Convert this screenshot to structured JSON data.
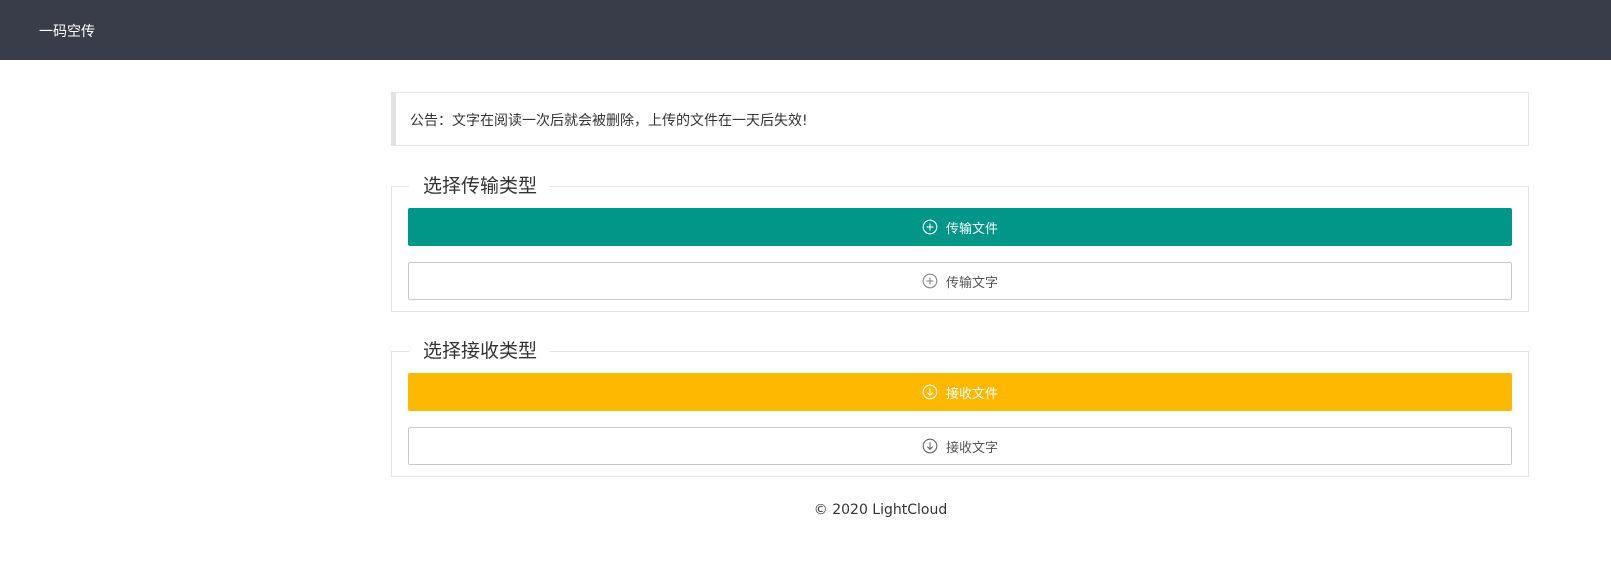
{
  "header": {
    "logo_text": "一码空传"
  },
  "notice": {
    "text": "公告：文字在阅读一次后就会被删除，上传的文件在一天后失效!"
  },
  "send_section": {
    "title": "选择传输类型",
    "send_file_label": "传输文件",
    "send_text_label": "传输文字",
    "send_file_icon": "plus-circle-icon",
    "send_text_icon": "plus-circle-icon"
  },
  "receive_section": {
    "title": "选择接收类型",
    "receive_file_label": "接收文件",
    "receive_text_label": "接收文字",
    "receive_file_icon": "download-circle-icon",
    "receive_text_icon": "download-circle-icon"
  },
  "footer": {
    "copyright": "© 2020 LightCloud"
  },
  "colors": {
    "header_bg": "#393d49",
    "teal": "#009688",
    "amber": "#ffb800"
  }
}
